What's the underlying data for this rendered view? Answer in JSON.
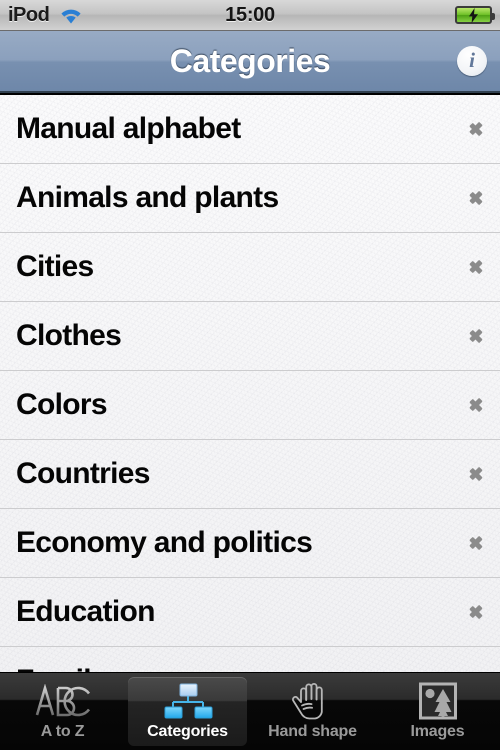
{
  "status_bar": {
    "carrier": "iPod",
    "wifi_icon": "wifi-icon",
    "time": "15:00",
    "battery_icon": "battery-charging-icon"
  },
  "nav_bar": {
    "title": "Categories",
    "info_button_label": "i",
    "info_icon": "info-icon",
    "gradient_top": "#98abc4",
    "gradient_bottom": "#6e87a9"
  },
  "list": {
    "rows": [
      {
        "label": "Manual alphabet",
        "chevron": "chevron-right-icon"
      },
      {
        "label": "Animals and plants",
        "chevron": "chevron-right-icon"
      },
      {
        "label": "Cities",
        "chevron": "chevron-right-icon"
      },
      {
        "label": "Clothes",
        "chevron": "chevron-right-icon"
      },
      {
        "label": "Colors",
        "chevron": "chevron-right-icon"
      },
      {
        "label": "Countries",
        "chevron": "chevron-right-icon"
      },
      {
        "label": "Economy and politics",
        "chevron": "chevron-right-icon"
      },
      {
        "label": "Education",
        "chevron": "chevron-right-icon"
      },
      {
        "label": "Family",
        "chevron": "chevron-right-icon"
      }
    ]
  },
  "tab_bar": {
    "selected_index": 1,
    "tabs": [
      {
        "label": "A to Z",
        "icon": "abc-icon"
      },
      {
        "label": "Categories",
        "icon": "hierarchy-icon"
      },
      {
        "label": "Hand shape",
        "icon": "hand-icon"
      },
      {
        "label": "Images",
        "icon": "image-icon"
      }
    ]
  },
  "colors": {
    "tab_selected_text": "#ffffff",
    "tab_text": "#9a9a9a",
    "row_text": "#050505",
    "chevron": "#8b8b8b",
    "battery_green": "#6fc128",
    "wifi_blue": "#2a7fd4",
    "hierarchy_blue": "#3fb8f0"
  }
}
